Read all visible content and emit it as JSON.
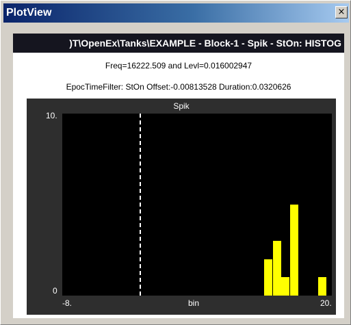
{
  "window": {
    "title": "PlotView",
    "close_glyph": "×",
    "accent": "#0a246a"
  },
  "header": {
    "path": ")T\\OpenEx\\Tanks\\EXAMPLE - Block-1 - Spik - StOn: HISTOG",
    "freq_line": "Freq=16222.509 and Levl=0.016002947",
    "filter_line": "EpocTimeFilter: StOn  Offset:-0.00813528  Duration:0.0320626"
  },
  "plot": {
    "panel_title": "Spik",
    "y_max_label": "10.",
    "y_min_label": "0",
    "x_min_label": "-8.",
    "x_max_label": "20.",
    "x_axis_label": "bin",
    "bar_color": "#ffff00",
    "background": "#000000"
  },
  "chart_data": {
    "type": "bar",
    "title": "Spik",
    "xlabel": "bin",
    "ylabel": "",
    "xlim": [
      -8,
      20
    ],
    "ylim": [
      0,
      10
    ],
    "bars": [
      {
        "x": 13.4,
        "value": 2.0
      },
      {
        "x": 14.3,
        "value": 3.0
      },
      {
        "x": 15.2,
        "value": 1.0
      },
      {
        "x": 16.1,
        "value": 5.0
      },
      {
        "x": 19.0,
        "value": 1.0
      }
    ],
    "marker_line": {
      "x": 0.0,
      "style": "dashed",
      "color": "#ffffff"
    }
  }
}
